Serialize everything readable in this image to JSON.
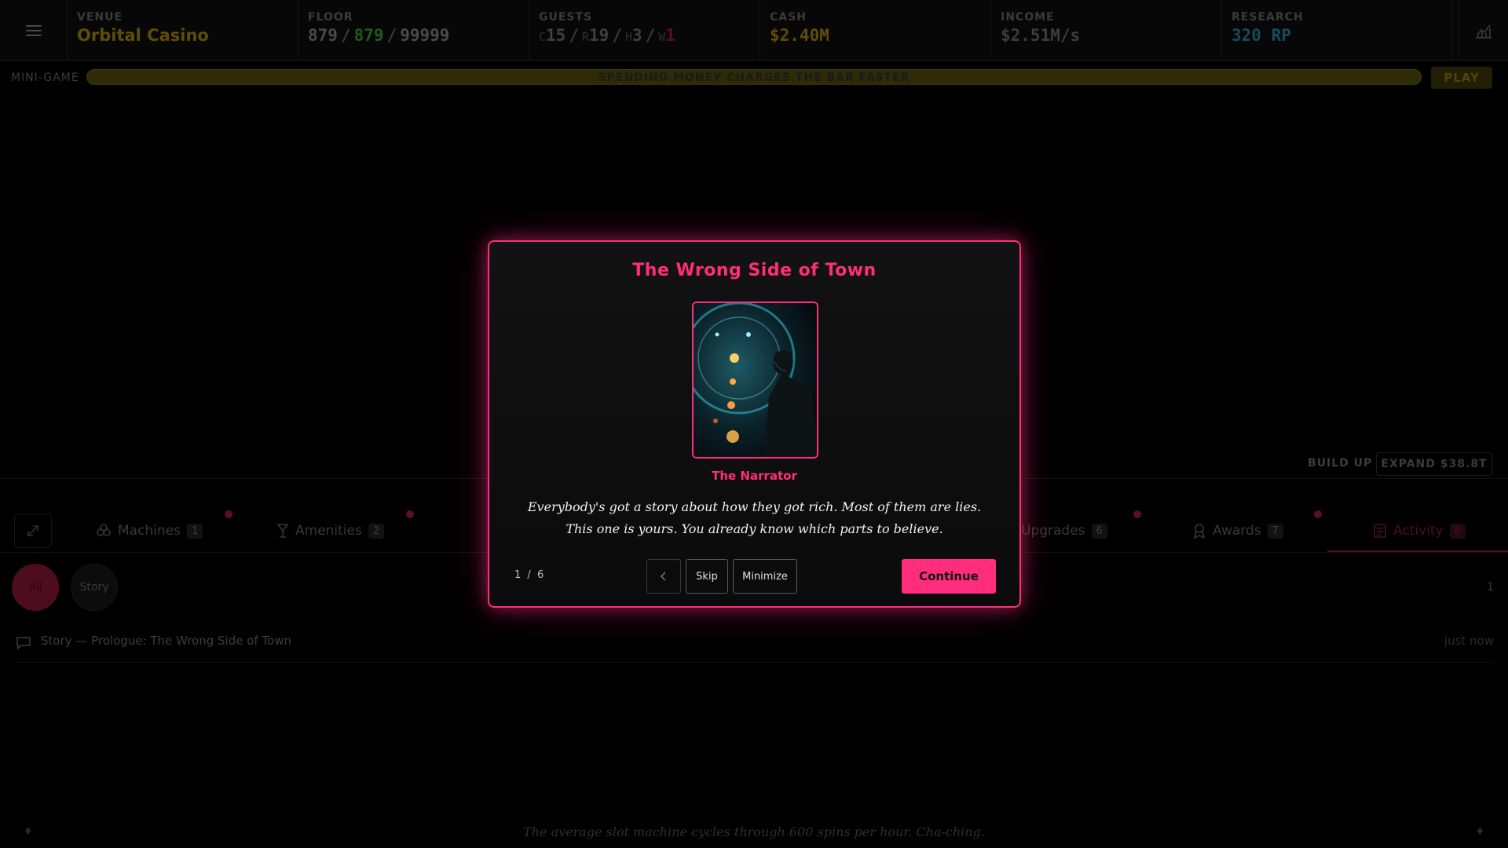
{
  "topbar": {
    "venue": {
      "label": "VENUE",
      "value": "Orbital Casino"
    },
    "floor": {
      "label": "FLOOR",
      "current": "879",
      "capacity": "879",
      "max": "99999",
      "separator": "/"
    },
    "guests": {
      "label": "GUESTS",
      "c_key": "C",
      "c_val": "15",
      "r_key": "R",
      "r_val": "19",
      "h_key": "H",
      "h_val": "3",
      "w_key": "W",
      "w_val": "1"
    },
    "cash": {
      "label": "CASH",
      "value": "$2.40M"
    },
    "income": {
      "label": "INCOME",
      "value": "$2.51M/s"
    },
    "research": {
      "label": "RESEARCH",
      "value": "320 RP"
    }
  },
  "minigame": {
    "label": "MINI-GAME",
    "bar_text": "SPENDING MONEY CHARGES THE BAR FASTER",
    "progress": 0.0,
    "play_label": "PLAY"
  },
  "build": {
    "label": "BUILD UP",
    "expand_label": "EXPAND $38.8T"
  },
  "tabs": [
    {
      "label": "Machines",
      "count": "1"
    },
    {
      "label": "Amenities",
      "count": "2"
    },
    {
      "label": "Upgrades",
      "count": "6"
    },
    {
      "label": "Awards",
      "count": "7"
    },
    {
      "label": "Activity",
      "count": "8"
    }
  ],
  "filters": {
    "all": "All",
    "story": "Story",
    "count": "1"
  },
  "log": [
    {
      "text": "Story — Prologue: The Wrong Side of Town",
      "time": "just now"
    }
  ],
  "footer": {
    "fact": "The average slot machine cycles through 600 spins per hour. Cha-ching."
  },
  "modal": {
    "title": "The Wrong Side of Town",
    "speaker": "The Narrator",
    "text": "Everybody's got a story about how they got rich. Most of them are lies. This one is yours. You already know which parts to believe.",
    "step_current": "1",
    "step_sep": "/",
    "step_total": "6",
    "skip_label": "Skip",
    "minimize_label": "Minimize",
    "continue_label": "Continue"
  },
  "colors": {
    "accent": "#ff2d7c",
    "gold": "#d6b21a",
    "green": "#3cb83c",
    "cyan": "#2aa8d8"
  },
  "icons": [
    "menu-icon",
    "chart-icon",
    "expand-icon",
    "machines-icon",
    "amenities-icon",
    "upgrades-icon",
    "awards-icon",
    "activity-icon",
    "chat-icon",
    "chevron-left-icon",
    "diamond-icon"
  ]
}
